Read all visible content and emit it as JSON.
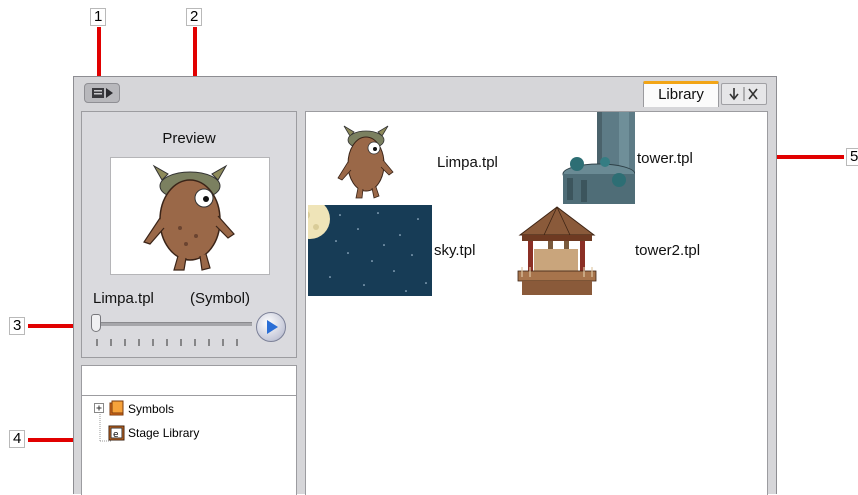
{
  "callouts": [
    "1",
    "2",
    "3",
    "4",
    "5"
  ],
  "window": {
    "menu_icon": "panel-menu-icon",
    "tab_label": "Library",
    "tab_controls": [
      "collapse-icon",
      "close-icon"
    ]
  },
  "preview": {
    "title": "Preview",
    "item_name": "Limpa.tpl",
    "item_type": "(Symbol)",
    "slider_position": 0,
    "play_icon": "play-icon"
  },
  "tree": {
    "search_value": "",
    "items": [
      {
        "label": "Symbols",
        "icon": "folder-icon",
        "expandable": true
      },
      {
        "label": "Stage Library",
        "icon": "library-icon",
        "expandable": false
      }
    ]
  },
  "library": {
    "items": [
      {
        "label": "Limpa.tpl",
        "thumbnail": "character"
      },
      {
        "label": "tower.tpl",
        "thumbnail": "tower"
      },
      {
        "label": "sky.tpl",
        "thumbnail": "night-sky"
      },
      {
        "label": "tower2.tpl",
        "thumbnail": "gazebo"
      }
    ]
  },
  "colors": {
    "callout_line": "#e10000",
    "tab_accent": "#f2a516",
    "panel_bg": "#d6d6d9",
    "sky_bg": "#173c56"
  }
}
